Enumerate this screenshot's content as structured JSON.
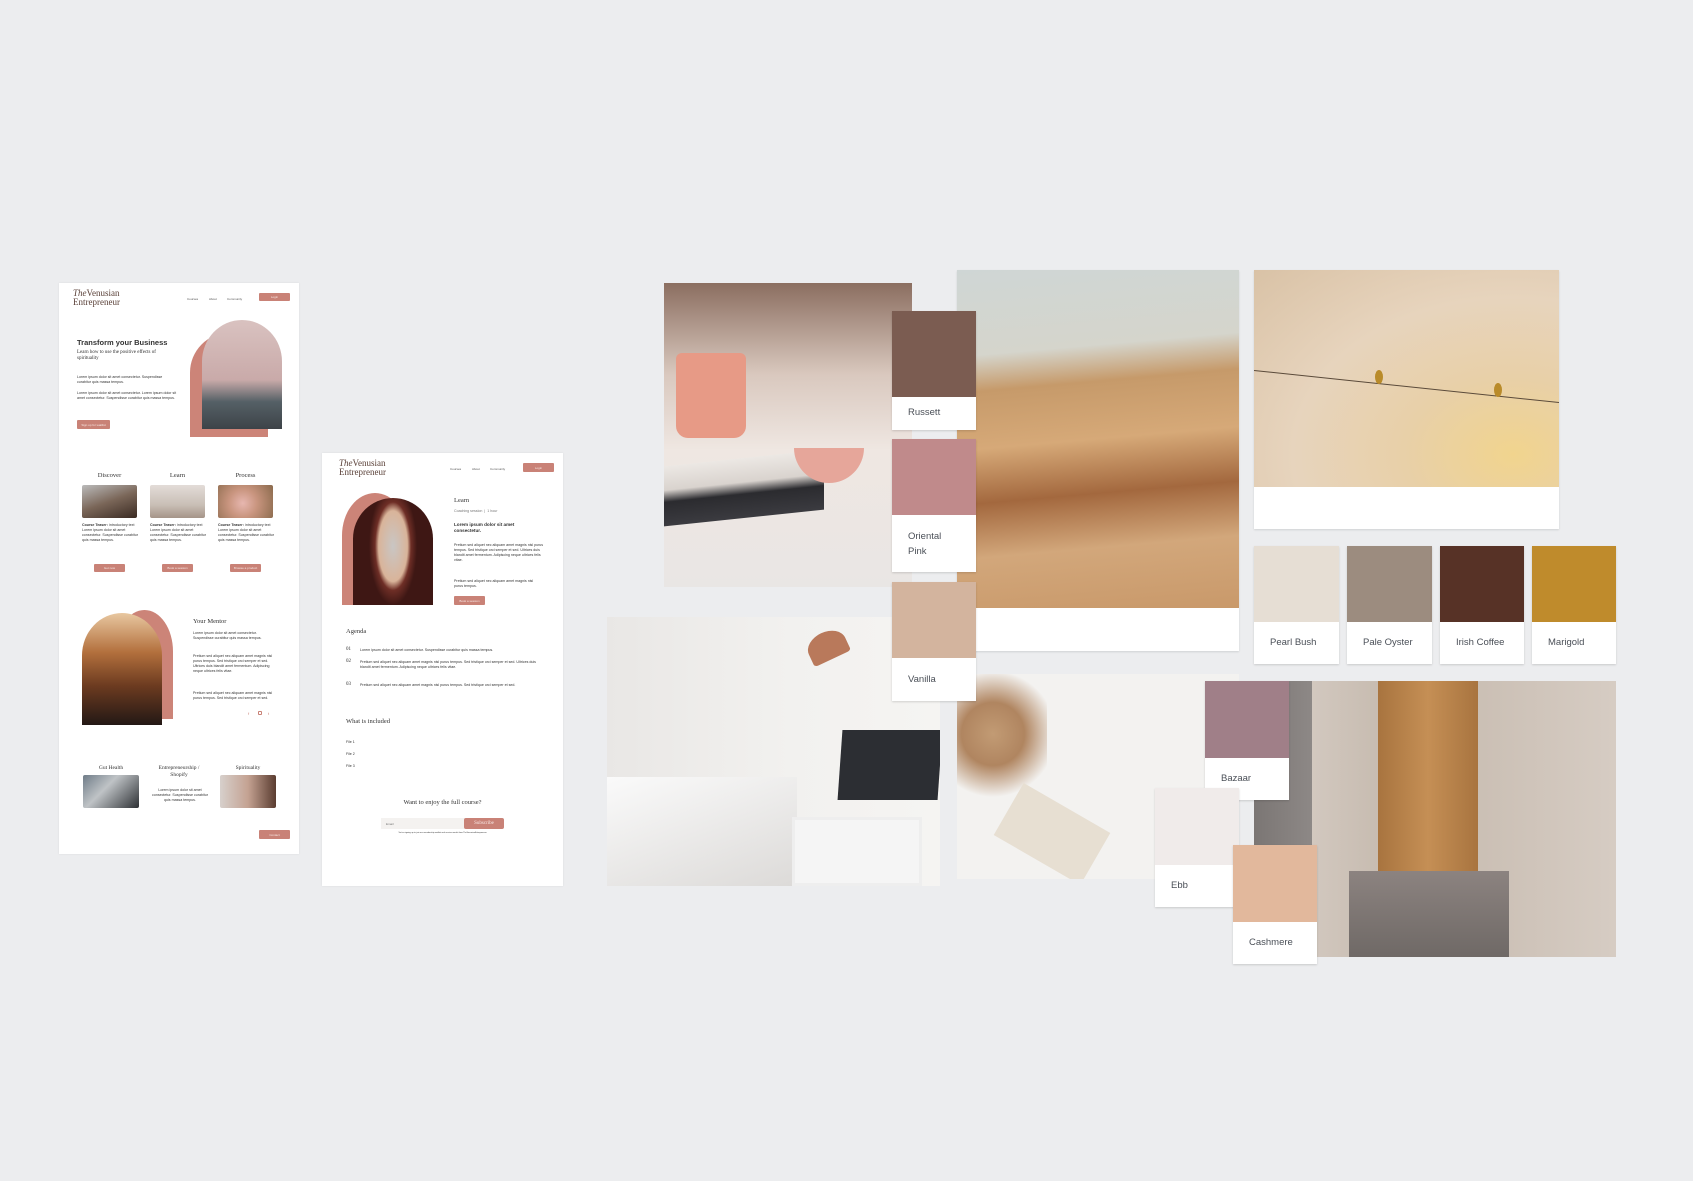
{
  "mockup_home": {
    "logo": {
      "the": "The",
      "line1": "Venusian",
      "line2": "Entrepreneur"
    },
    "nav": [
      "Courses",
      "About",
      "Community"
    ],
    "login": "Login",
    "hero": {
      "title": "Transform your Business",
      "subtitle": "Learn how to use the positive effects of spirituality",
      "p1": "Lorem ipsum dolor sit amet consectetur. Suspendisse curabitur quis massa tempus.",
      "p2": "Lorem ipsum dolor sit amet consectetur. Lorem ipsum dolor sit amet consectetur. Suspendisse curabitur quis massa tempus.",
      "cta": "Sign up for waitlist"
    },
    "sections": [
      {
        "title": "Discover",
        "teaser": "Course Teaser:",
        "teaser_rest": " introductory text",
        "body": "Lorem ipsum dolor sit amet consectetur. Suspendisse curabitur quis massa tempus.",
        "button": "Get now"
      },
      {
        "title": "Learn",
        "teaser": "Course Teaser:",
        "teaser_rest": " introductory text",
        "body": "Lorem ipsum dolor sit amet consectetur. Suspendisse curabitur quis massa tempus.",
        "button": "Book a session"
      },
      {
        "title": "Process",
        "teaser": "Course Teaser:",
        "teaser_rest": " introductory text",
        "body": "Lorem ipsum dolor sit amet consectetur. Suspendisse curabitur quis massa tempus.",
        "button": "Browse a product"
      }
    ],
    "mentor": {
      "title": "Your Mentor",
      "p1": "Lorem ipsum dolor sit amet consectetur. Suspendisse curabitur quis massa tempus.",
      "p2": "Pretium sed aliquet nec aliquam amet magnis nisl purus tempus. Sed tristique orci semper et sed. Ultrices duis blandit amet fermentum. Adipiscing neque ultrices felis vitae.",
      "p3": "Pretium sed aliquet nec aliquam amet magnis nisl purus tempus. Sed tristique orci semper et sed."
    },
    "topics": [
      {
        "title": "Gut Health"
      },
      {
        "title": "Entrepreneurship / Shopify",
        "body": "Lorem ipsum dolor sit amet consectetur. Suspendisse curabitur quis massa tempus."
      },
      {
        "title": "Spirituality"
      }
    ],
    "contact": "Contact"
  },
  "mockup_course": {
    "logo": {
      "the": "The",
      "line1": "Venusian",
      "line2": "Entrepreneur"
    },
    "nav": [
      "Courses",
      "About",
      "Community"
    ],
    "login": "Login",
    "title": "Learn",
    "meta": "Coaching session  |  1 hour",
    "lead": "Lorem ipsum dolor sit amet consectetur.",
    "p1": "Pretium sed aliquet nec aliquam amet magnis nisl purus tempus. Sed tristique orci semper et sed. Ultrices duis blandit amet fermentum. Adipiscing neque ultrices felis vitae.",
    "p2": "Pretium sed aliquet nec aliquam amet magnis nisl purus tempus.",
    "cta": "Book a session",
    "agenda_title": "Agenda",
    "agenda": [
      {
        "num": "01",
        "text": "Lorem ipsum dolor sit amet consectetur. Suspendisse curabitur quis massa tempus."
      },
      {
        "num": "02",
        "text": "Pretium sed aliquet nec aliquam amet magnis nisl purus tempus. Sed tristique orci semper et sed. Ultrices duis blandit amet fermentum. Adipiscing neque ultrices felis vitae."
      },
      {
        "num": "03",
        "text": "Pretium sed aliquet nec aliquam amet magnis nisl purus tempus. Sed tristique orci semper et sed."
      }
    ],
    "included_title": "What is included",
    "files": [
      "File 1",
      "File 2",
      "File 3"
    ],
    "subscribe_title": "Want to enjoy the full course?",
    "email_placeholder": "Email",
    "subscribe": "Subscribe",
    "disclaimer": "You're signing up to join our membership waitlist and receive emails from TheVenusianEntrepreneur"
  },
  "swatches": [
    {
      "name": "Russett",
      "color": "#7b5c51"
    },
    {
      "name": "Oriental Pink",
      "color": "#c08a8b"
    },
    {
      "name": "Vanilla",
      "color": "#d3b49e"
    },
    {
      "name": "Pearl Bush",
      "color": "#e6ded4"
    },
    {
      "name": "Pale Oyster",
      "color": "#9c8c7f"
    },
    {
      "name": "Irish Coffee",
      "color": "#573226"
    },
    {
      "name": "Marigold",
      "color": "#bf8b2c"
    },
    {
      "name": "Bazaar",
      "color": "#a07f88"
    },
    {
      "name": "Ebb",
      "color": "#f0ebea"
    },
    {
      "name": "Cashmere",
      "color": "#e2b89c"
    }
  ]
}
